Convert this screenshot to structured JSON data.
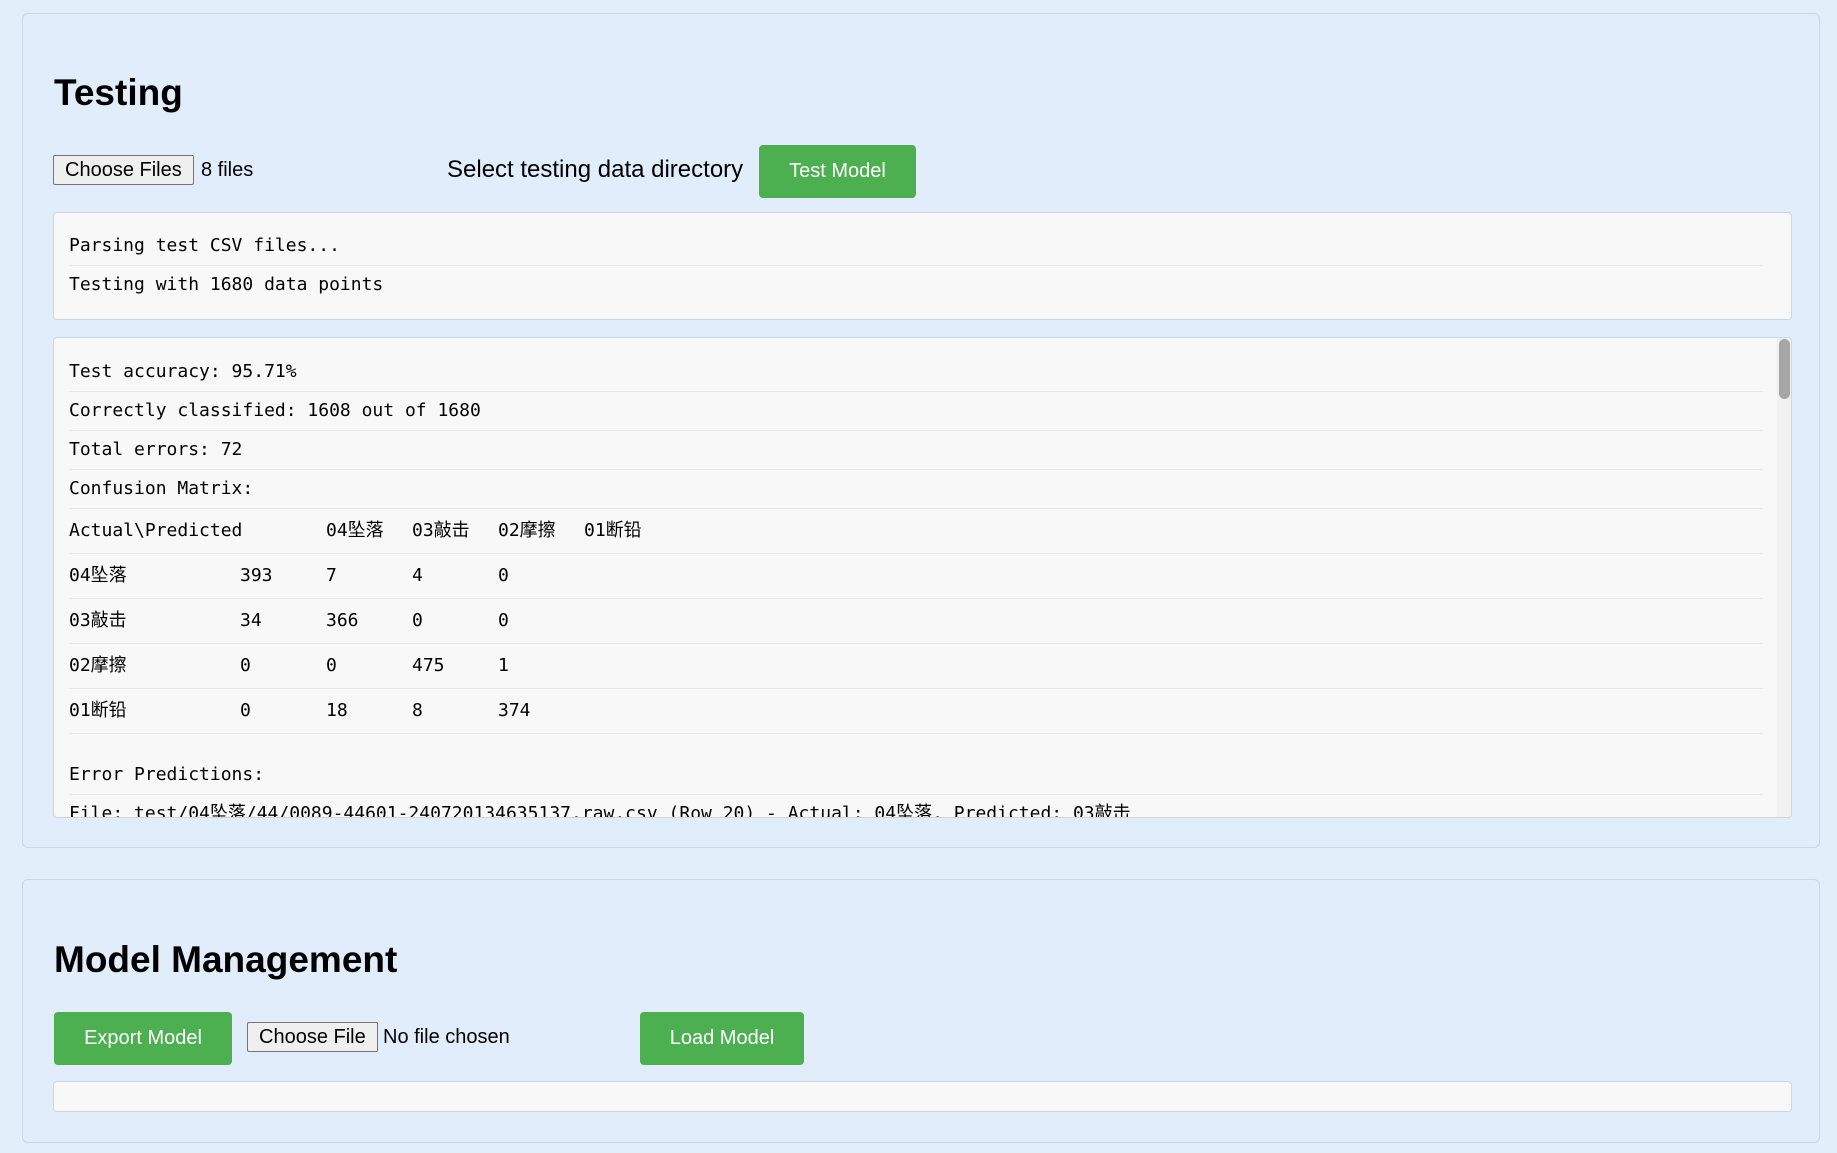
{
  "testing": {
    "title": "Testing",
    "choose_files_label": "Choose Files",
    "files_status": "8 files",
    "directory_label": "Select testing data directory",
    "test_button_label": "Test Model",
    "status_lines": [
      "Parsing test CSV files...",
      "Testing with 1680 data points"
    ],
    "results": {
      "accuracy_line": "Test accuracy: 95.71%",
      "correct_line": "Correctly classified: 1608 out of 1680",
      "errors_line": "Total errors: 72",
      "confusion_title": "Confusion Matrix:",
      "matrix_corner": "Actual\\Predicted",
      "matrix_columns": [
        "04坠落",
        "03敲击",
        "02摩擦",
        "01断铅"
      ],
      "matrix_rows": [
        {
          "label": "04坠落",
          "values": [
            "393",
            "7",
            "4",
            "0"
          ]
        },
        {
          "label": "03敲击",
          "values": [
            "34",
            "366",
            "0",
            "0"
          ]
        },
        {
          "label": "02摩擦",
          "values": [
            "0",
            "0",
            "475",
            "1"
          ]
        },
        {
          "label": "01断铅",
          "values": [
            "0",
            "18",
            "8",
            "374"
          ]
        }
      ],
      "error_predictions_title": "Error Predictions:",
      "error_line_partial": "File: test/04坠落/44/0089-44601-240720134635137.raw.csv (Row 20) - Actual: 04坠落, Predicted: 03敲击"
    }
  },
  "model_management": {
    "title": "Model Management",
    "export_button_label": "Export Model",
    "choose_file_label": "Choose File",
    "file_status": "No file chosen",
    "load_button_label": "Load Model"
  },
  "colors": {
    "accent": "#4caf50",
    "background": "#e1edfb",
    "log_background": "#f8f8f8"
  }
}
